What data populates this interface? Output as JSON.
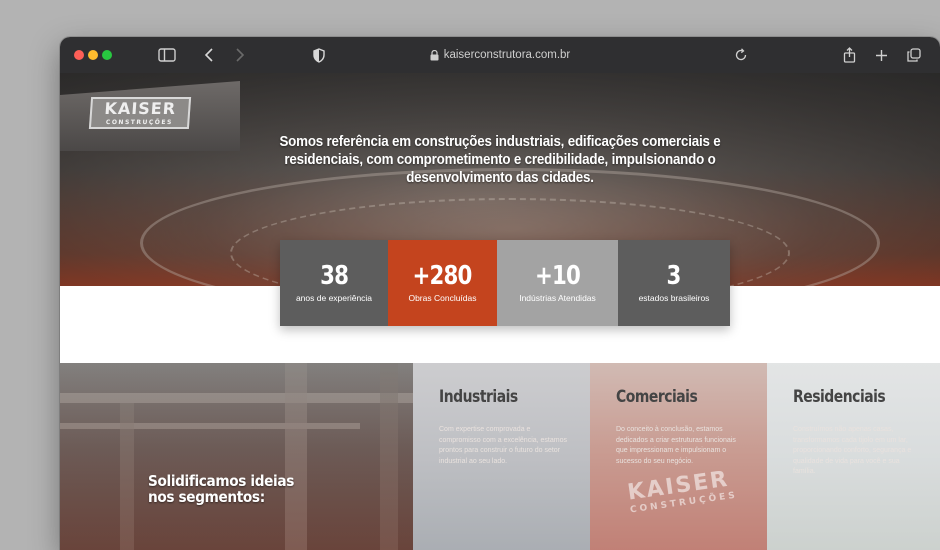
{
  "browser": {
    "url": "kaiserconstrutora.com.br"
  },
  "hero": {
    "sign_brand": "KAISER",
    "sign_sub": "CONSTRUÇÕES",
    "headline": "Somos referência em construções industriais, edificações comerciais e residenciais, com comprometimento e credibilidade, impulsionando o desenvolvimento das cidades."
  },
  "stats": [
    {
      "value": "38",
      "label": "anos de experiência",
      "color": "#5d5d5d"
    },
    {
      "value": "+280",
      "label": "Obras Concluídas",
      "color": "#c4441e"
    },
    {
      "value": "+10",
      "label": "Indústrias Atendidas",
      "color": "#a3a3a3"
    },
    {
      "value": "3",
      "label": "estados brasileiros",
      "color": "#5d5d5d"
    }
  ],
  "segments": {
    "title_line1": "Solidificamos ideias",
    "title_line2": "nos segmentos:",
    "cards": [
      {
        "title": "Industriais",
        "text": "Com expertise comprovada e compromisso com a excelência, estamos prontos para construir o futuro do setor industrial ao seu lado."
      },
      {
        "title": "Comerciais",
        "text": "Do conceito à conclusão, estamos dedicados a criar estruturas funcionais que impressionam e impulsionam o sucesso do seu negócio."
      },
      {
        "title": "Residenciais",
        "text": "Construímos não apenas casas, transformamos cada tijolo em um lar, proporcionando conforto, segurança e qualidade de vida para você e sua família."
      }
    ],
    "commercial_sign_brand": "KAISER",
    "commercial_sign_sub": "CONSTRUÇÕES"
  },
  "colors": {
    "accent": "#c4441e",
    "dark_gray": "#5d5d5d",
    "light_gray": "#a3a3a3"
  }
}
